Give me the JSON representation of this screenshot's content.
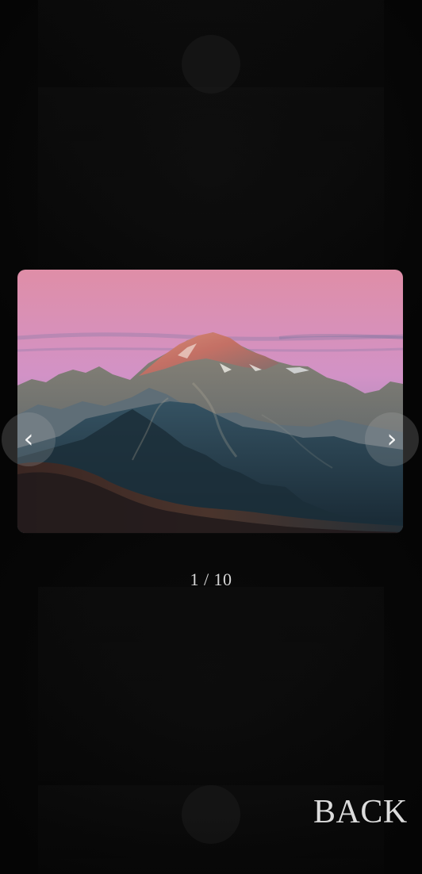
{
  "viewer": {
    "counter": "1 / 10",
    "current_index": 1,
    "total_images": 10
  },
  "navigation": {
    "previous_symbol": "‹",
    "next_symbol": "›"
  },
  "footer": {
    "back_label": "BACK"
  },
  "colors": {
    "background": "#050505",
    "text": "#dcdcdc",
    "nav_button": "rgba(180,180,180,0.22)"
  },
  "icons": {
    "previous": "chevron-left-icon",
    "next": "chevron-right-icon"
  }
}
